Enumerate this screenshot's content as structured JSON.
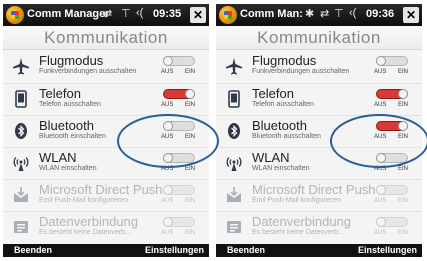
{
  "screens": [
    {
      "status": {
        "app_title": "Comm Manager",
        "time": "09:35",
        "icons": [
          "sync-icon",
          "signal-icon",
          "speaker-icon"
        ]
      },
      "header": "Kommunikation",
      "rows": [
        {
          "name": "Flugmodus",
          "desc": "Funkverbindungen ausschalten",
          "icon": "airplane-icon",
          "on": false,
          "disabled": false
        },
        {
          "name": "Telefon",
          "desc": "Telefon ausschalten",
          "icon": "phone-icon",
          "on": true,
          "disabled": false
        },
        {
          "name": "Bluetooth",
          "desc": "Bluetooth einschalten",
          "icon": "bluetooth-icon",
          "on": false,
          "disabled": false
        },
        {
          "name": "WLAN",
          "desc": "WLAN einschalten",
          "icon": "wlan-icon",
          "on": false,
          "disabled": false
        },
        {
          "name": "Microsoft Direct Push",
          "desc": "Emil Push-Mail konfigurieren",
          "icon": "mail-icon",
          "on": false,
          "disabled": true
        },
        {
          "name": "Datenverbindung",
          "desc": "Es besteht keine Datenverb...",
          "icon": "data-icon",
          "on": false,
          "disabled": true
        }
      ],
      "toggle_labels": {
        "off": "AUS",
        "on": "EIN"
      },
      "softkeys": {
        "left": "Beenden",
        "right": "Einstellungen"
      }
    },
    {
      "status": {
        "app_title": "Comm Man:",
        "time": "09:36",
        "icons": [
          "bluetooth-status-icon",
          "sync-icon",
          "signal-icon",
          "speaker-icon"
        ]
      },
      "header": "Kommunikation",
      "rows": [
        {
          "name": "Flugmodus",
          "desc": "Funkverbindungen ausschalten",
          "icon": "airplane-icon",
          "on": false,
          "disabled": false
        },
        {
          "name": "Telefon",
          "desc": "Telefon ausschalten",
          "icon": "phone-icon",
          "on": true,
          "disabled": false
        },
        {
          "name": "Bluetooth",
          "desc": "Bluetooth ausschalten",
          "icon": "bluetooth-icon",
          "on": true,
          "disabled": false
        },
        {
          "name": "WLAN",
          "desc": "WLAN einschalten",
          "icon": "wlan-icon",
          "on": false,
          "disabled": false
        },
        {
          "name": "Microsoft Direct Push",
          "desc": "Emil Push-Mail konfigurieren",
          "icon": "mail-icon",
          "on": false,
          "disabled": true
        },
        {
          "name": "Datenverbindung",
          "desc": "Es besteht keine Datenverb...",
          "icon": "data-icon",
          "on": false,
          "disabled": true
        }
      ],
      "toggle_labels": {
        "off": "AUS",
        "on": "EIN"
      },
      "softkeys": {
        "left": "Beenden",
        "right": "Einstellungen"
      }
    }
  ],
  "colors": {
    "toggle_on": "#d83a3a",
    "highlight_ellipse": "#2b5e95"
  }
}
